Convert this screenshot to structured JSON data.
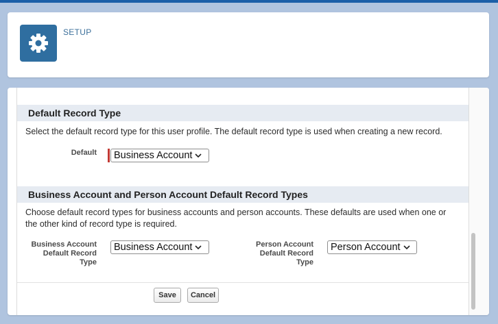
{
  "header": {
    "title": "SETUP",
    "icon": "gear-icon",
    "icon_color": "#2f6ea0"
  },
  "sections": [
    {
      "title": "Default Record Type",
      "description": "Select the default record type for this user profile. The default record type is used when creating a new record.",
      "fields": [
        {
          "label": "Default",
          "value": "Business Account",
          "required": true
        }
      ]
    },
    {
      "title": "Business Account and Person Account Default Record Types",
      "description_line1": "Choose default record types for business accounts and person accounts. These defaults are used when one or",
      "description_line2": "the other kind of record type is required.",
      "fields": [
        {
          "label_line1": "Business Account",
          "label_line2": "Default Record",
          "label_line3": "Type",
          "value": "Business Account"
        },
        {
          "label_line1": "Person Account",
          "label_line2": "Default Record",
          "label_line3": "Type",
          "value": "Person Account"
        }
      ]
    }
  ],
  "buttons": {
    "save": "Save",
    "cancel": "Cancel"
  },
  "colors": {
    "required_marker": "#c23934",
    "section_header_bg": "#e6ebf2",
    "page_bg": "#b0c4df"
  }
}
